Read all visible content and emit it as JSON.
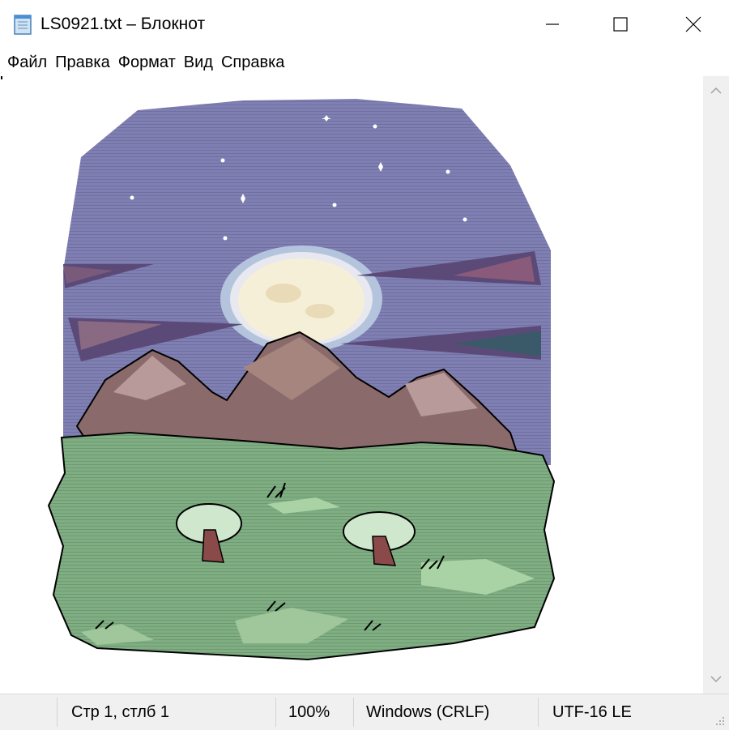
{
  "window": {
    "title": "LS0921.txt – Блокнот",
    "controls": {
      "minimize": "minimize-icon",
      "maximize": "maximize-icon",
      "close": "close-icon"
    }
  },
  "menu": {
    "items": [
      {
        "label": "Файл"
      },
      {
        "label": "Правка"
      },
      {
        "label": "Формат"
      },
      {
        "label": "Вид"
      },
      {
        "label": "Справка"
      }
    ]
  },
  "editor": {
    "content_description_icon": "ascii-art-landscape",
    "colors": {
      "sky": "#7f7fb4",
      "moon": "#f4ecd0",
      "mountain": "#8a6a6a",
      "grass": "#7fae83",
      "tree_trunk": "#8a4a4a"
    }
  },
  "statusbar": {
    "position": "Стр 1, стлб 1",
    "zoom": "100%",
    "line_endings": "Windows (CRLF)",
    "encoding": "UTF-16 LE"
  }
}
